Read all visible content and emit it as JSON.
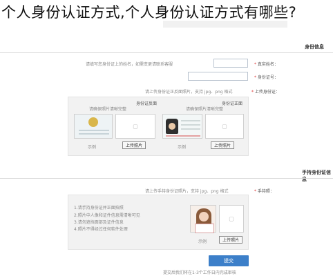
{
  "title": "个人身份认证方式,个人身份认证方式有哪些?",
  "top_section": {
    "heading": "身份信息"
  },
  "form": {
    "name_label": "真实姓名：",
    "name_hint": "请填写您身份证上的姓名，如需变更请联系客服",
    "id_label": "身份证号：",
    "upload_label": "上传身份证：",
    "upload_hint": "请上传身份证正反面照片，支持 jpg、png 格式"
  },
  "id_panel": {
    "front_title": "身份证正面",
    "back_title": "身份证反面",
    "left_note": "请确保照片清晰完整",
    "right_note": "请确保照片清晰完整",
    "sample_label": "示例",
    "upload_button": "上传照片"
  },
  "second_section": {
    "heading": "手持身份证信息",
    "label": "手持照：",
    "hint": "请上传手持身份证照片，支持 jpg、png 格式",
    "instructions": [
      "1.请手持身份证并正面拍照",
      "2.照片中人像和证件信息需清晰可见",
      "3.请勿遮挡面部及证件信息",
      "4.照片不得经过任何软件处理"
    ],
    "sample_label": "示例",
    "upload_button": "上传照片"
  },
  "submit": {
    "label": "提交"
  },
  "bottom_note": "提交后我们将在1-3个工作日内完成审核"
}
